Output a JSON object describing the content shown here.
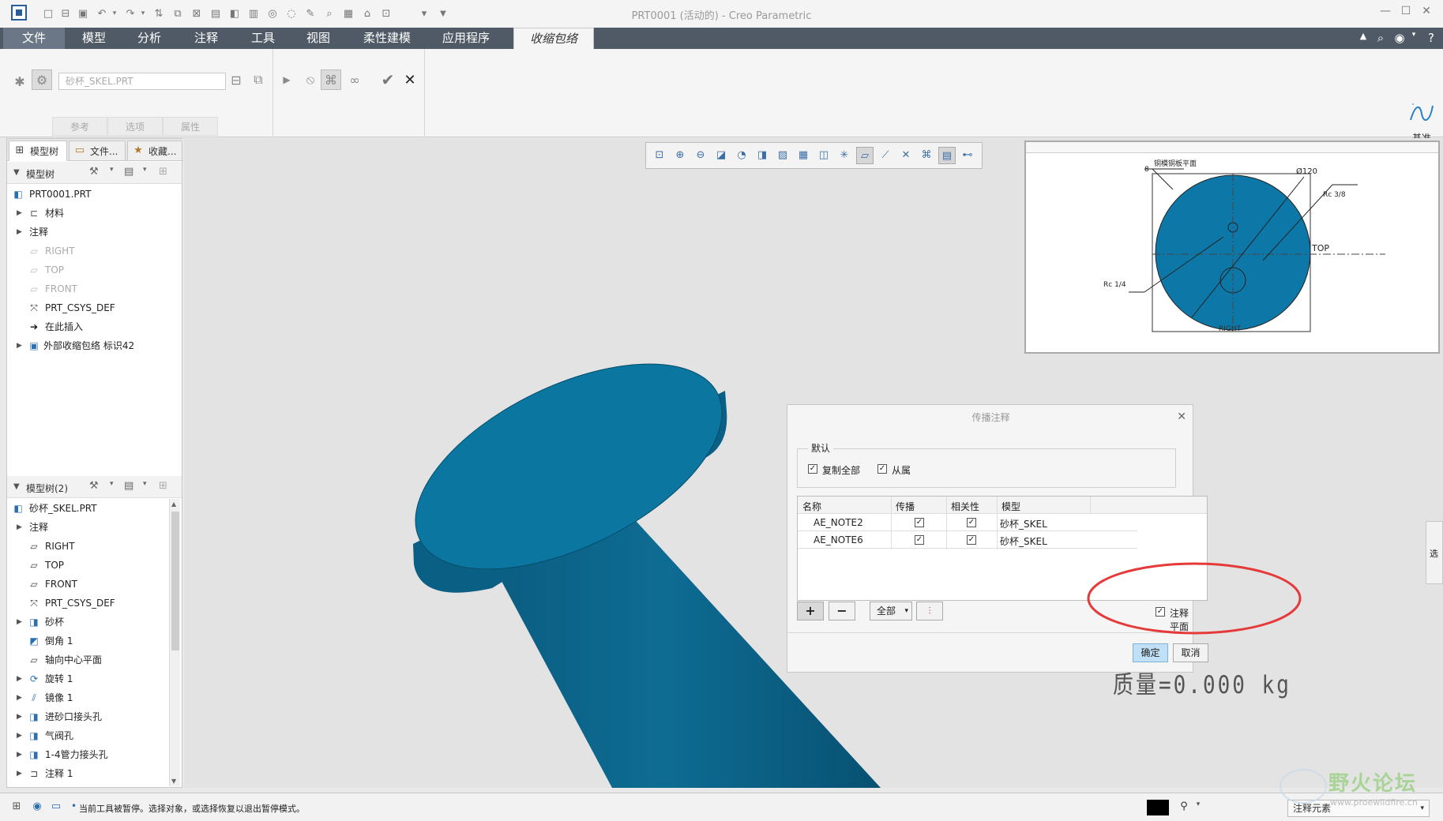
{
  "window": {
    "title": "PRT0001 (活动的) - Creo Parametric"
  },
  "tabs": [
    "文件",
    "模型",
    "分析",
    "注释",
    "工具",
    "视图",
    "柔性建模",
    "应用程序",
    "收缩包络"
  ],
  "ribbon": {
    "reference_value": "砂杯_SKEL.PRT",
    "subtabs": [
      "参考",
      "选项",
      "属性"
    ],
    "datum_label": "基准"
  },
  "nav_tabs": [
    "模型树",
    "文件...",
    "收藏..."
  ],
  "tree1": {
    "header": "模型树",
    "items": [
      {
        "label": "PRT0001.PRT"
      },
      {
        "label": "材料"
      },
      {
        "label": "注释"
      },
      {
        "label": "RIGHT"
      },
      {
        "label": "TOP"
      },
      {
        "label": "FRONT"
      },
      {
        "label": "PRT_CSYS_DEF"
      },
      {
        "label": "在此插入"
      },
      {
        "label": "外部收缩包络 标识42"
      }
    ]
  },
  "tree2": {
    "header": "模型树(2)",
    "items": [
      {
        "label": "砂杯_SKEL.PRT"
      },
      {
        "label": "注释"
      },
      {
        "label": "RIGHT"
      },
      {
        "label": "TOP"
      },
      {
        "label": "FRONT"
      },
      {
        "label": "PRT_CSYS_DEF"
      },
      {
        "label": "砂杯"
      },
      {
        "label": "倒角 1"
      },
      {
        "label": "轴向中心平面"
      },
      {
        "label": "旋转 1"
      },
      {
        "label": "镜像 1"
      },
      {
        "label": "进砂口接头孔"
      },
      {
        "label": "气阀孔"
      },
      {
        "label": "1-4管力接头孔"
      },
      {
        "label": "注释 1"
      }
    ]
  },
  "drawing": {
    "labels": {
      "top_label": "铜模铜板平面",
      "diameter": "Ø120",
      "rc38": "Rc 3/8",
      "top": "TOP",
      "rc14": "Rc 1/4",
      "n8": "8",
      "right": "RIGHT"
    }
  },
  "mass": "质量=0.000 kg",
  "dialog": {
    "title": "传播注释",
    "group_label": "默认",
    "copy_all": "复制全部",
    "dependent": "从属",
    "columns": [
      "名称",
      "传播",
      "相关性",
      "模型"
    ],
    "rows": [
      {
        "name": "AE_NOTE2",
        "model": "砂杯_SKEL"
      },
      {
        "name": "AE_NOTE6",
        "model": "砂杯_SKEL"
      }
    ],
    "all_label": "全部",
    "annotation_plane": "注释平面",
    "ok": "确定",
    "cancel": "取消"
  },
  "right_edge": {
    "label": "选"
  },
  "status": {
    "message": "当前工具被暂停。选择对象，或选择恢复以退出暂停模式。",
    "filter": "注释元素"
  },
  "watermark": {
    "text": "野火论坛",
    "url": "www.proewildfire.cn"
  },
  "colors": {
    "tabbar": "#505a66",
    "model_blue": "#0f6f98",
    "highlight_circle": "#e53a3a",
    "ok_button": "#bfe0f6"
  }
}
